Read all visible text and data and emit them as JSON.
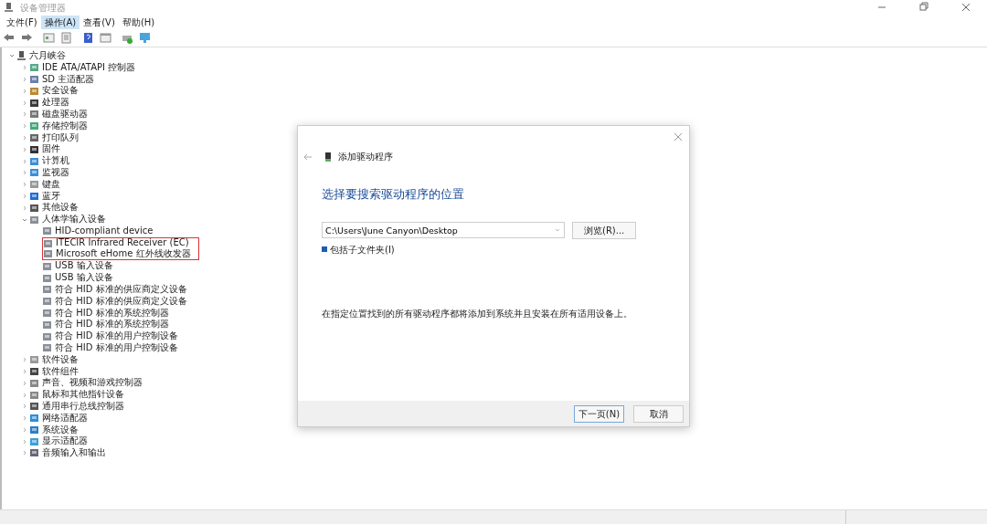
{
  "window": {
    "title": "设备管理器"
  },
  "menu": [
    {
      "label": "文件(F)",
      "selected": false
    },
    {
      "label": "操作(A)",
      "selected": true
    },
    {
      "label": "查看(V)",
      "selected": false
    },
    {
      "label": "帮助(H)",
      "selected": false
    }
  ],
  "tree": {
    "label": "六月峡谷",
    "expanded": true,
    "children": [
      {
        "label": "IDE ATA/ATAPI 控制器",
        "expanded": false
      },
      {
        "label": "SD 主适配器",
        "expanded": false
      },
      {
        "label": "安全设备",
        "expanded": false
      },
      {
        "label": "处理器",
        "expanded": false
      },
      {
        "label": "磁盘驱动器",
        "expanded": false
      },
      {
        "label": "存储控制器",
        "expanded": false
      },
      {
        "label": "打印队列",
        "expanded": false
      },
      {
        "label": "固件",
        "expanded": false
      },
      {
        "label": "计算机",
        "expanded": false
      },
      {
        "label": "监视器",
        "expanded": false
      },
      {
        "label": "键盘",
        "expanded": false
      },
      {
        "label": "蓝牙",
        "expanded": false
      },
      {
        "label": "其他设备",
        "expanded": false
      },
      {
        "label": "人体学输入设备",
        "expanded": true,
        "children": [
          {
            "label": "HID-compliant device",
            "highlighted": false
          },
          {
            "label": "ITECIR Infrared Receiver (EC)",
            "highlighted": true
          },
          {
            "label": "Microsoft eHome 红外线收发器",
            "highlighted": true
          },
          {
            "label": "USB 输入设备",
            "highlighted": false
          },
          {
            "label": "USB 输入设备",
            "highlighted": false
          },
          {
            "label": "符合 HID 标准的供应商定义设备",
            "highlighted": false
          },
          {
            "label": "符合 HID 标准的供应商定义设备",
            "highlighted": false
          },
          {
            "label": "符合 HID 标准的系统控制器",
            "highlighted": false
          },
          {
            "label": "符合 HID 标准的系统控制器",
            "highlighted": false
          },
          {
            "label": "符合 HID 标准的用户控制设备",
            "highlighted": false
          },
          {
            "label": "符合 HID 标准的用户控制设备",
            "highlighted": false
          }
        ]
      },
      {
        "label": "软件设备",
        "expanded": false
      },
      {
        "label": "软件组件",
        "expanded": false
      },
      {
        "label": "声音、视频和游戏控制器",
        "expanded": false
      },
      {
        "label": "鼠标和其他指针设备",
        "expanded": false
      },
      {
        "label": "通用串行总线控制器",
        "expanded": false
      },
      {
        "label": "网络适配器",
        "expanded": false
      },
      {
        "label": "系统设备",
        "expanded": false
      },
      {
        "label": "显示适配器",
        "expanded": false
      },
      {
        "label": "音频输入和输出",
        "expanded": false
      }
    ]
  },
  "dialog": {
    "title": "添加驱动程序",
    "heading": "选择要搜索驱动程序的位置",
    "path": "C:\\Users\\June Canyon\\Desktop",
    "browse": "浏览(R)...",
    "include_subfolders": {
      "label": "包括子文件夹(I)",
      "checked": true
    },
    "description": "在指定位置找到的所有驱动程序都将添加到系统并且安装在所有适用设备上。",
    "next": "下一页(N)",
    "cancel": "取消"
  }
}
